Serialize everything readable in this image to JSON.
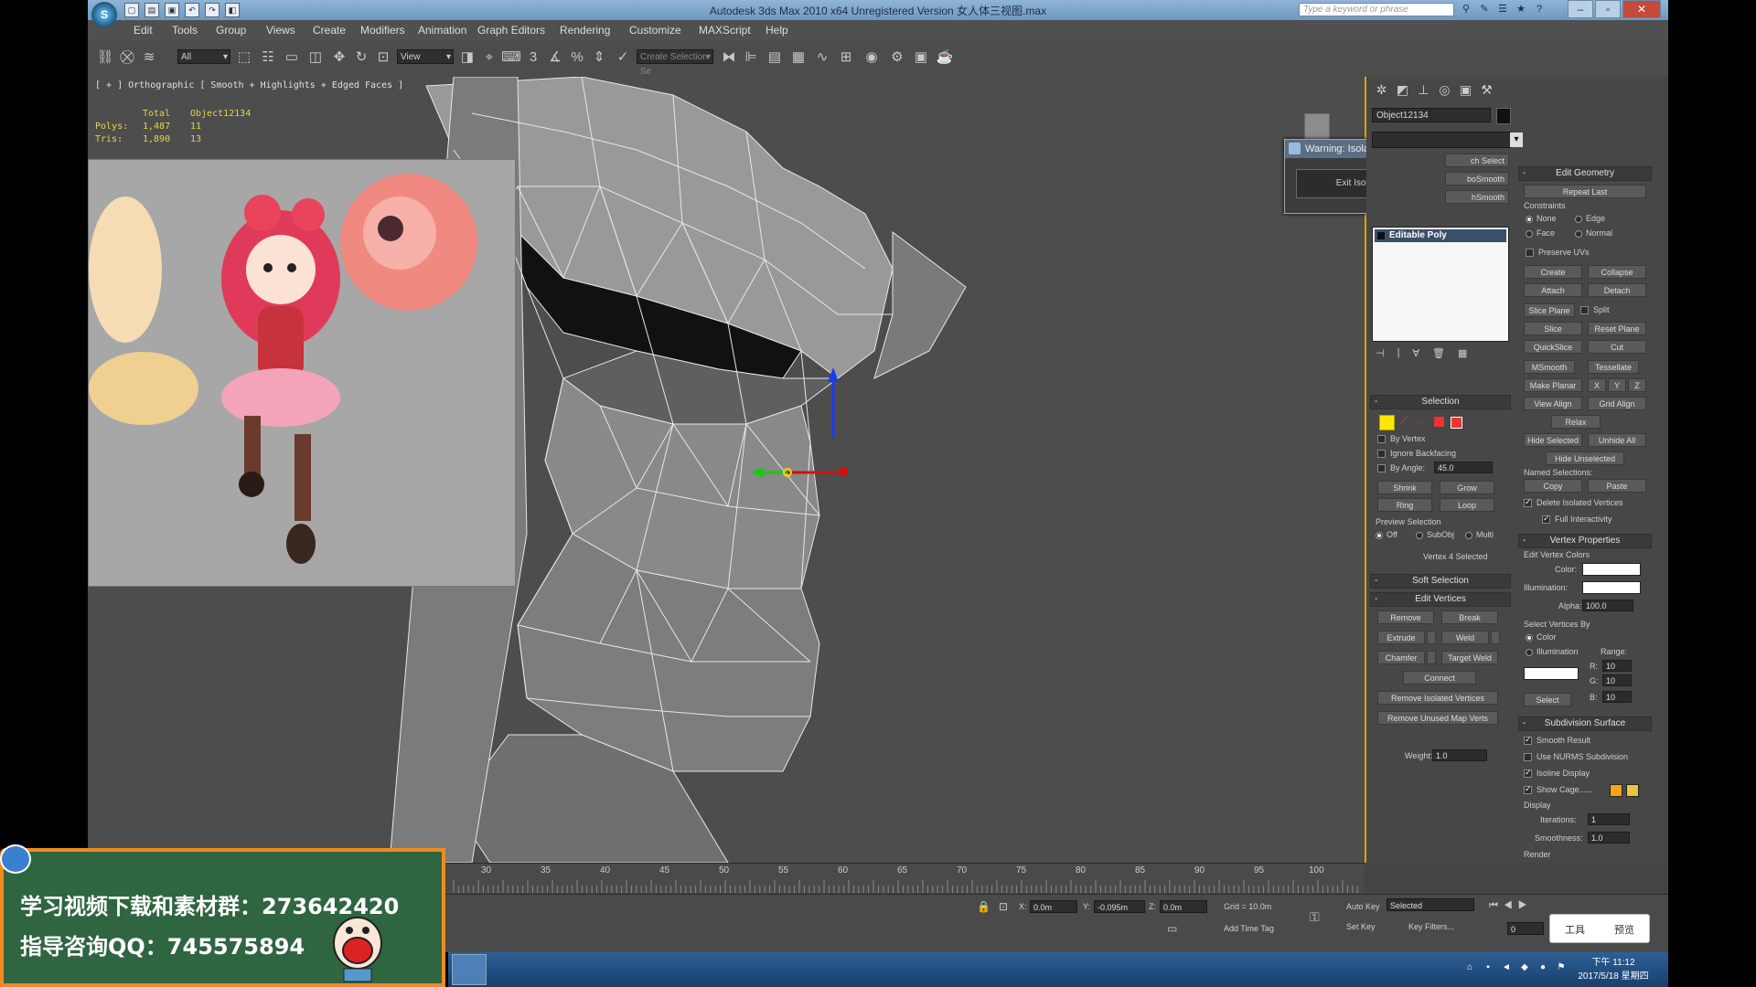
{
  "window": {
    "title": "Autodesk 3ds Max  2010 x64    Unregistered Version      女人体三视图.max",
    "search_placeholder": "Type a keyword or phrase",
    "logo": "3ds-max-logo",
    "minimize": "–",
    "maximize": "▫",
    "close": "✕"
  },
  "menu": [
    "Edit",
    "Tools",
    "Group",
    "Views",
    "Create",
    "Modifiers",
    "Animation",
    "Graph Editors",
    "Rendering",
    "Customize",
    "MAXScript",
    "Help"
  ],
  "toolbar": {
    "filter": "All",
    "coord_system": "View",
    "named_selection_placeholder": "Create Selection Se",
    "snap_label": "3"
  },
  "viewport": {
    "label": "[ + ] Orthographic  [ Smooth + Highlights + Edged Faces ]",
    "stats": {
      "header": [
        "",
        "Total",
        "Object12134"
      ],
      "rows": [
        [
          "Polys:",
          "1,487",
          "11"
        ],
        [
          "Tris:",
          "1,890",
          "13"
        ]
      ]
    },
    "colors": {
      "background": "#4d4d4d",
      "active_border": "#e1a400"
    }
  },
  "dialog": {
    "title": "Warning: Isolated Sel...",
    "close": "✕",
    "button": "Exit Isolation Mode"
  },
  "command_panel": {
    "object_name": "Object12134",
    "partial_buttons": [
      "ch Select",
      "boSmooth",
      "hSmooth"
    ],
    "stack_item": "Editable Poly",
    "selection": {
      "title": "Selection",
      "by_vertex": "By Vertex",
      "ignore_backfacing": "Ignore Backfacing",
      "by_angle": "By Angle:",
      "angle_value": "45.0",
      "shrink": "Shrink",
      "grow": "Grow",
      "ring": "Ring",
      "loop": "Loop",
      "preview_title": "Preview Selection",
      "preview_off": "Off",
      "preview_subobj": "SubObj",
      "preview_multi": "Multi",
      "status": "Vertex 4 Selected"
    },
    "soft_selection": "Soft Selection",
    "edit_vertices": {
      "title": "Edit Vertices",
      "remove": "Remove",
      "break": "Break",
      "extrude": "Extrude",
      "weld": "Weld",
      "chamfer": "Chamfer",
      "target_weld": "Target Weld",
      "connect": "Connect",
      "remove_isolated": "Remove Isolated Vertices",
      "remove_unused": "Remove Unused Map Verts",
      "weight_label": "Weight:",
      "weight_value": "1.0"
    },
    "edit_geometry": {
      "title": "Edit Geometry",
      "repeat_last": "Repeat Last",
      "constraints": "Constraints",
      "none": "None",
      "edge": "Edge",
      "face": "Face",
      "normal": "Normal",
      "preserve_uvs": "Preserve UVs",
      "create": "Create",
      "collapse": "Collapse",
      "attach": "Attach",
      "detach": "Detach",
      "slice_plane": "Slice Plane",
      "split": "Split",
      "slice": "Slice",
      "reset_plane": "Reset Plane",
      "quickslice": "QuickSlice",
      "cut": "Cut",
      "msmooth": "MSmooth",
      "tessellate": "Tessellate",
      "make_planar": "Make Planar",
      "x": "X",
      "y": "Y",
      "z": "Z",
      "view_align": "View Align",
      "grid_align": "Grid Align",
      "relax": "Relax",
      "hide_selected": "Hide Selected",
      "unhide_all": "Unhide All",
      "hide_unselected": "Hide Unselected",
      "named_selections": "Named Selections:",
      "copy": "Copy",
      "paste": "Paste",
      "delete_isolated": "Delete Isolated Vertices",
      "full_interactivity": "Full Interactivity"
    },
    "vertex_properties": {
      "title": "Vertex Properties",
      "edit_vertex_colors": "Edit Vertex Colors",
      "color": "Color:",
      "illumination": "Illumination:",
      "alpha": "Alpha:",
      "alpha_value": "100.0",
      "select_by": "Select Vertices By",
      "by_color": "Color",
      "by_illumination": "Illumination",
      "range": "Range:",
      "r": "R:",
      "g": "G:",
      "b": "B:",
      "r_value": "10",
      "g_value": "10",
      "b_value": "10",
      "select": "Select"
    },
    "subdivision": {
      "title": "Subdivision Surface",
      "smooth_result": "Smooth Result",
      "use_nurms": "Use NURMS Subdivision",
      "isoline": "Isoline Display",
      "show_cage": "Show Cage......",
      "display": "Display",
      "iterations": "Iterations:",
      "iterations_value": "1",
      "smoothness": "Smoothness:",
      "smoothness_value": "1.0",
      "render": "Render",
      "cage_colors": [
        "#f5a31a",
        "#e8c840"
      ]
    }
  },
  "timeline": {
    "ticks": [
      "30",
      "35",
      "40",
      "45",
      "50",
      "55",
      "60",
      "65",
      "70",
      "75",
      "80",
      "85",
      "90",
      "95",
      "100"
    ]
  },
  "status": {
    "x_label": "X:",
    "x": "0.0m",
    "y_label": "Y:",
    "y": "-0.095m",
    "z_label": "Z:",
    "z": "0.0m",
    "grid": "Grid = 10.0m",
    "auto_key": "Auto Key",
    "set_key": "Set Key",
    "key_mode": "Selected",
    "key_filters": "Key Filters...",
    "add_time_tag": "Add Time Tag",
    "frame": "0"
  },
  "taskbar": {
    "time": "下午 11:12",
    "date": "2017/5/18 星期四"
  },
  "ime": {
    "tools": "工具",
    "preview": "预览"
  },
  "ad": {
    "line1": "学习视频下载和素材群：273642420",
    "line2": "指导咨询QQ：745575894"
  }
}
